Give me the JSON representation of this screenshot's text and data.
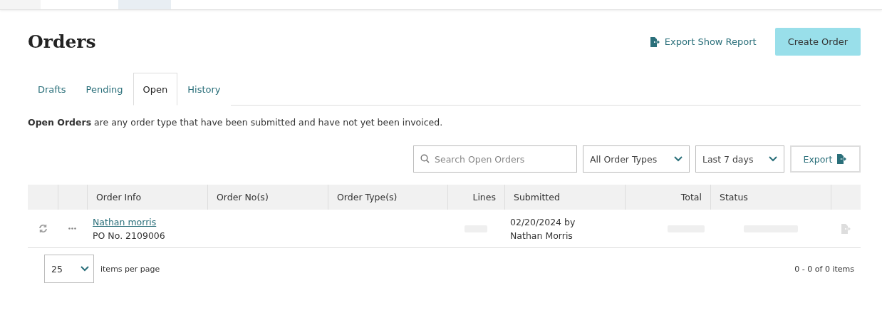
{
  "page": {
    "title": "Orders"
  },
  "actions": {
    "export_report": "Export Show Report",
    "create": "Create Order"
  },
  "tabs": [
    {
      "label": "Drafts",
      "selected": false
    },
    {
      "label": "Pending",
      "selected": false
    },
    {
      "label": "Open",
      "selected": true
    },
    {
      "label": "History",
      "selected": false
    }
  ],
  "description": "**Open Orders** are any order type that have been submitted and have not yet been invoiced.",
  "filters": {
    "search": {
      "placeholder": "Search Open Orders"
    },
    "order_type": "All Order Types",
    "date_range": "Last 7 days",
    "export": "Export"
  },
  "table": {
    "columns": [
      "",
      "",
      "Order Info",
      "Order No(s)",
      "Order Type(s)",
      "Lines",
      "Submitted",
      "Total",
      "Status",
      ""
    ],
    "rows": [
      {
        "name": "Nathan morris",
        "po": "PO No. 2109006",
        "submitted": "02/20/2024 by",
        "submitted_by": "Nathan Morris"
      }
    ]
  },
  "pagination": {
    "page_size": "25",
    "label": "items per page",
    "summary": "0 - 0 of 0 items"
  }
}
